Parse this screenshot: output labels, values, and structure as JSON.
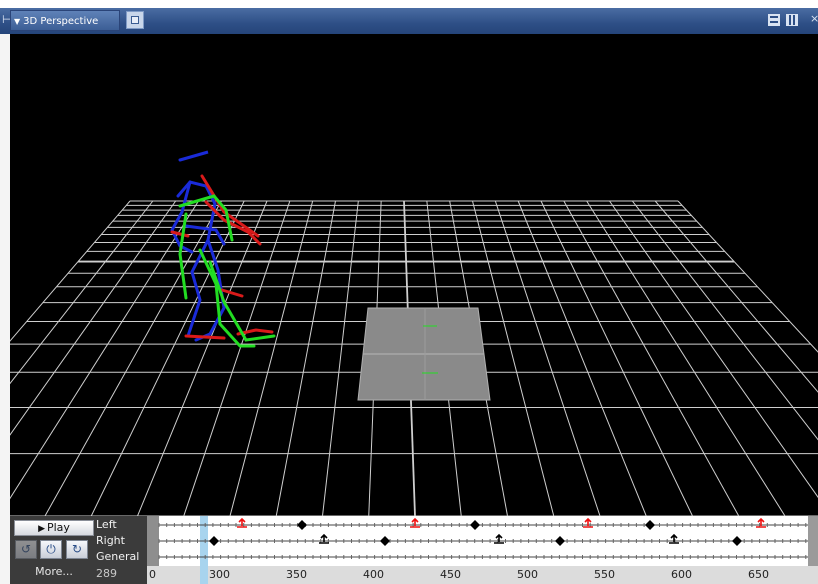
{
  "titlebar": {
    "view_tab_label": "3D Perspective"
  },
  "timeline": {
    "play_label": "Play",
    "more_label": "More...",
    "tracks": [
      "Left",
      "Right",
      "General"
    ],
    "current_frame": "289",
    "ruler_labels": [
      "0",
      "300",
      "350",
      "400",
      "450",
      "500",
      "550",
      "600",
      "650"
    ]
  },
  "colors": {
    "titlebar": "#2e4f86",
    "viewport_background": "#000000",
    "grid_line": "#cfcfcf",
    "ground_patch": "#8a8a8a",
    "skeleton_blue": "#1a2bd9",
    "skeleton_red": "#d91a1a",
    "skeleton_green": "#22dd22",
    "playhead": "#a8d4ee",
    "left_foot_key": "#ee1111",
    "right_foot_key": "#000000"
  },
  "icons": {
    "dropdown": "triangle-down-icon",
    "camera": "camera-view-icon",
    "play": "play-triangle-icon",
    "rewind": "rewind-icon",
    "power": "power-icon",
    "redo": "redo-icon",
    "foot_lift": "lift-key-icon",
    "foot_plant": "diamond-key-icon"
  }
}
